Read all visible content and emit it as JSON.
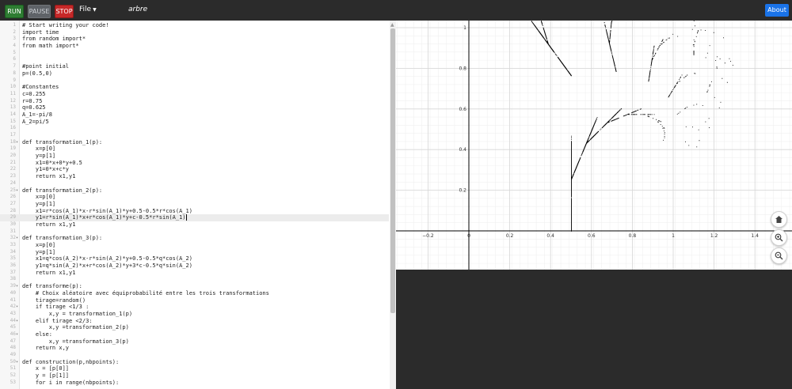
{
  "toolbar": {
    "run_label": "RUN",
    "pause_label": "PAUSE",
    "stop_label": "STOP",
    "file_label": "File",
    "program_name": "arbre",
    "about_label": "About"
  },
  "editor": {
    "lines": [
      {
        "n": "1",
        "fold": "",
        "text": "# Start writing your code!"
      },
      {
        "n": "2",
        "fold": "",
        "text": "import time"
      },
      {
        "n": "3",
        "fold": "",
        "text": "from random import*"
      },
      {
        "n": "4",
        "fold": "",
        "text": "from math import*"
      },
      {
        "n": "5",
        "fold": "",
        "text": ""
      },
      {
        "n": "6",
        "fold": "",
        "text": ""
      },
      {
        "n": "7",
        "fold": "",
        "text": "#point initial"
      },
      {
        "n": "8",
        "fold": "",
        "text": "p=(0.5,0)"
      },
      {
        "n": "9",
        "fold": "",
        "text": ""
      },
      {
        "n": "10",
        "fold": "",
        "text": "#Constantes"
      },
      {
        "n": "11",
        "fold": "",
        "text": "c=0.255"
      },
      {
        "n": "12",
        "fold": "",
        "text": "r=0.75"
      },
      {
        "n": "13",
        "fold": "",
        "text": "q=0.625"
      },
      {
        "n": "14",
        "fold": "",
        "text": "A_1=-pi/8"
      },
      {
        "n": "15",
        "fold": "",
        "text": "A_2=pi/5"
      },
      {
        "n": "16",
        "fold": "",
        "text": ""
      },
      {
        "n": "17",
        "fold": "",
        "text": ""
      },
      {
        "n": "18",
        "fold": "▾",
        "text": "def transformation_1(p):"
      },
      {
        "n": "19",
        "fold": "",
        "text": "    x=p[0]"
      },
      {
        "n": "20",
        "fold": "",
        "text": "    y=p[1]"
      },
      {
        "n": "21",
        "fold": "",
        "text": "    x1=0*x+0*y+0.5"
      },
      {
        "n": "22",
        "fold": "",
        "text": "    y1=0*x+c*y"
      },
      {
        "n": "23",
        "fold": "",
        "text": "    return x1,y1"
      },
      {
        "n": "24",
        "fold": "",
        "text": ""
      },
      {
        "n": "25",
        "fold": "▾",
        "text": "def transformation_2(p):"
      },
      {
        "n": "26",
        "fold": "",
        "text": "    x=p[0]"
      },
      {
        "n": "27",
        "fold": "",
        "text": "    y=p[1]"
      },
      {
        "n": "28",
        "fold": "",
        "text": "    x1=r*cos(A_1)*x-r*sin(A_1)*y+0.5-0.5*r*cos(A_1)"
      },
      {
        "n": "29",
        "fold": "",
        "text": "    y1=r*sin(A_1)*x+r*cos(A_1)*y+c-0.5*r*sin(A_1)"
      },
      {
        "n": "30",
        "fold": "",
        "text": "    return x1,y1"
      },
      {
        "n": "31",
        "fold": "",
        "text": ""
      },
      {
        "n": "32",
        "fold": "▾",
        "text": "def transformation_3(p):"
      },
      {
        "n": "33",
        "fold": "",
        "text": "    x=p[0]"
      },
      {
        "n": "34",
        "fold": "",
        "text": "    y=p[1]"
      },
      {
        "n": "35",
        "fold": "",
        "text": "    x1=q*cos(A_2)*x-r*sin(A_2)*y+0.5-0.5*q*cos(A_2)"
      },
      {
        "n": "36",
        "fold": "",
        "text": "    y1=q*sin(A_2)*x+r*cos(A_2)*y+3*c-0.5*q*sin(A_2)"
      },
      {
        "n": "37",
        "fold": "",
        "text": "    return x1,y1"
      },
      {
        "n": "38",
        "fold": "",
        "text": ""
      },
      {
        "n": "39",
        "fold": "▾",
        "text": "def transforme(p):"
      },
      {
        "n": "40",
        "fold": "",
        "text": "    # Choix aléatoire avec équiprobabilité entre les trois transformations"
      },
      {
        "n": "41",
        "fold": "",
        "text": "    tirage=random()"
      },
      {
        "n": "42",
        "fold": "▾",
        "text": "    if tirage <1/3 :"
      },
      {
        "n": "43",
        "fold": "",
        "text": "        x,y = transformation_1(p)"
      },
      {
        "n": "44",
        "fold": "▾",
        "text": "    elif tirage <2/3:"
      },
      {
        "n": "45",
        "fold": "",
        "text": "        x,y =transformation_2(p)"
      },
      {
        "n": "46",
        "fold": "▾",
        "text": "    else:"
      },
      {
        "n": "47",
        "fold": "",
        "text": "        x,y =transformation_3(p)"
      },
      {
        "n": "48",
        "fold": "",
        "text": "    return x,y"
      },
      {
        "n": "49",
        "fold": "",
        "text": ""
      },
      {
        "n": "50",
        "fold": "▾",
        "text": "def construction(p,nbpoints):"
      },
      {
        "n": "51",
        "fold": "",
        "text": "    x = [p[0]]"
      },
      {
        "n": "52",
        "fold": "",
        "text": "    y = [p[1]]"
      },
      {
        "n": "53",
        "fold": "",
        "text": "    for i in range(nbpoints):"
      }
    ],
    "active_line_index": 28
  },
  "plot": {
    "x_ticks": [
      "−0.2",
      "0",
      "0.2",
      "0.4",
      "0.6",
      "0.8",
      "1",
      "1.2",
      "1.4"
    ],
    "y_ticks": [
      "0.2",
      "0.4",
      "0.6",
      "0.8",
      "1"
    ],
    "xlim": [
      -0.35,
      1.6
    ],
    "ylim": [
      -0.2,
      1.02
    ],
    "grid": true,
    "point_color": "#000000",
    "controls": [
      "home-icon",
      "zoom-in-icon",
      "zoom-out-icon"
    ]
  }
}
